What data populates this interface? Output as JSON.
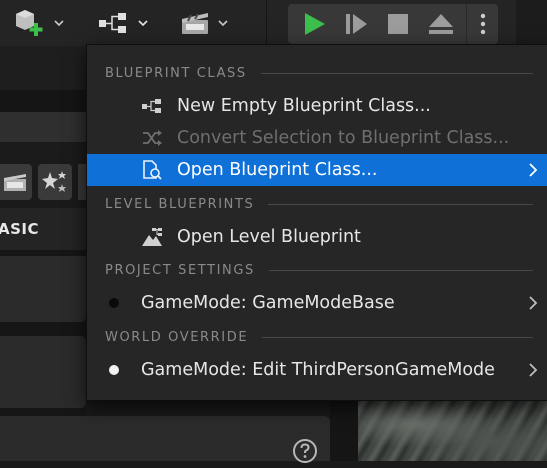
{
  "toolbar": {
    "icons": [
      "add-content-icon",
      "blueprint-icon",
      "cinematics-icon"
    ],
    "play_controls": [
      "play-icon",
      "step-icon",
      "stop-icon",
      "eject-icon",
      "more-options-icon"
    ]
  },
  "left_panel": {
    "mode_label": "ASIC",
    "mode_icons": [
      "clapperboard-icon",
      "effects-icon"
    ]
  },
  "footer": {
    "help_icon": "help-icon"
  },
  "menu": {
    "sections": {
      "blueprint_class": "BLUEPRINT CLASS",
      "level_blueprints": "LEVEL BLUEPRINTS",
      "project_settings": "PROJECT SETTINGS",
      "world_override": "WORLD OVERRIDE"
    },
    "items": {
      "new_empty": "New Empty Blueprint Class...",
      "convert_selection": "Convert Selection to Blueprint Class...",
      "open_class": "Open Blueprint Class...",
      "open_level": "Open Level Blueprint",
      "gamemode_base": "GameMode: GameModeBase",
      "gamemode_edit": "GameMode: Edit ThirdPersonGameMode"
    },
    "highlight_color": "#0F70D7",
    "disabled_color": "#6F6F6F"
  },
  "colors": {
    "play_green": "#3CC04B",
    "menu_bg": "#262626",
    "toolbar_bg": "#242424"
  }
}
